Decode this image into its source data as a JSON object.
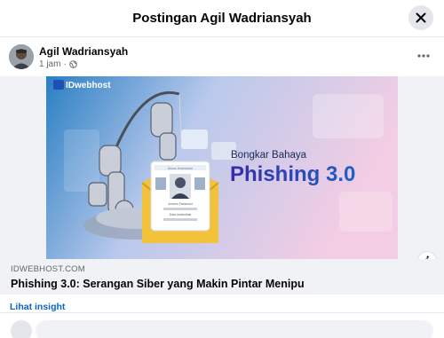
{
  "dialog": {
    "title": "Postingan Agil Wadriansyah",
    "close_icon": "close-icon"
  },
  "post": {
    "author": "Agil Wadriansyah",
    "time": "1 jam",
    "separator": "·",
    "audience_icon": "globe-icon",
    "more_icon": "more-horizontal-icon"
  },
  "link_preview": {
    "image": {
      "brand": "IDwebhost",
      "headline_small": "Bongkar Bahaya",
      "headline_big": "Phishing 3.0",
      "card_heading": "Akses Keamanan",
      "card_field_1": "Anonim Password",
      "card_field_2": "Data credentials",
      "colors": {
        "bg_left": "#2a7fc3",
        "bg_right": "#f3cde3",
        "headline": "#1d3fa3",
        "envelope": "#f2c23b"
      }
    },
    "info_label": "i",
    "domain": "IDWEBHOST.COM",
    "title": "Phishing 3.0: Serangan Siber yang Makin Pintar Menipu"
  },
  "insight_link": "Lihat insight",
  "colors": {
    "link_blue": "#0a66c2",
    "muted": "#65676b",
    "card_bg": "#f0f2f5"
  }
}
